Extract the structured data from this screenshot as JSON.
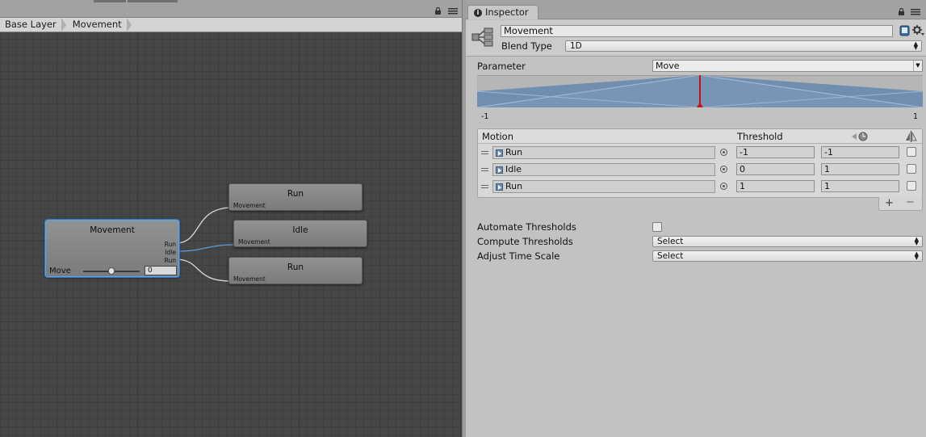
{
  "animator": {
    "breadcrumb": [
      "Base Layer",
      "Movement"
    ],
    "nodes": {
      "movement": {
        "title": "Movement",
        "ports": [
          "Run",
          "Idle",
          "Run"
        ],
        "param_label": "Move",
        "param_value": "0",
        "slider_fraction": 0.5
      },
      "run_top": {
        "title": "Run",
        "parent": "Movement"
      },
      "idle": {
        "title": "Idle",
        "parent": "Movement"
      },
      "run_bottom": {
        "title": "Run",
        "parent": "Movement"
      }
    }
  },
  "inspector": {
    "tab_label": "Inspector",
    "name": "Movement",
    "blend_type_label": "Blend Type",
    "blend_type_value": "1D",
    "parameter_label": "Parameter",
    "parameter_value": "Move",
    "graph_min": "-1",
    "graph_max": "1",
    "graph_marker_value": 0,
    "motion_header": "Motion",
    "threshold_header": "Threshold",
    "motions": [
      {
        "clip": "Run",
        "threshold": "-1",
        "time_scale": "-1",
        "mirror": false
      },
      {
        "clip": "Idle",
        "threshold": "0",
        "time_scale": "1",
        "mirror": false
      },
      {
        "clip": "Run",
        "threshold": "1",
        "time_scale": "1",
        "mirror": false
      }
    ],
    "add_label": "+",
    "remove_label": "−",
    "automate_label": "Automate Thresholds",
    "automate_value": false,
    "compute_label": "Compute Thresholds",
    "compute_value": "Select",
    "adjust_label": "Adjust Time Scale",
    "adjust_value": "Select"
  },
  "colors": {
    "selection": "#5aa8e8",
    "graph_fill": "#6f8eb0",
    "graph_marker": "#cc1111",
    "canvas": "#464646"
  }
}
